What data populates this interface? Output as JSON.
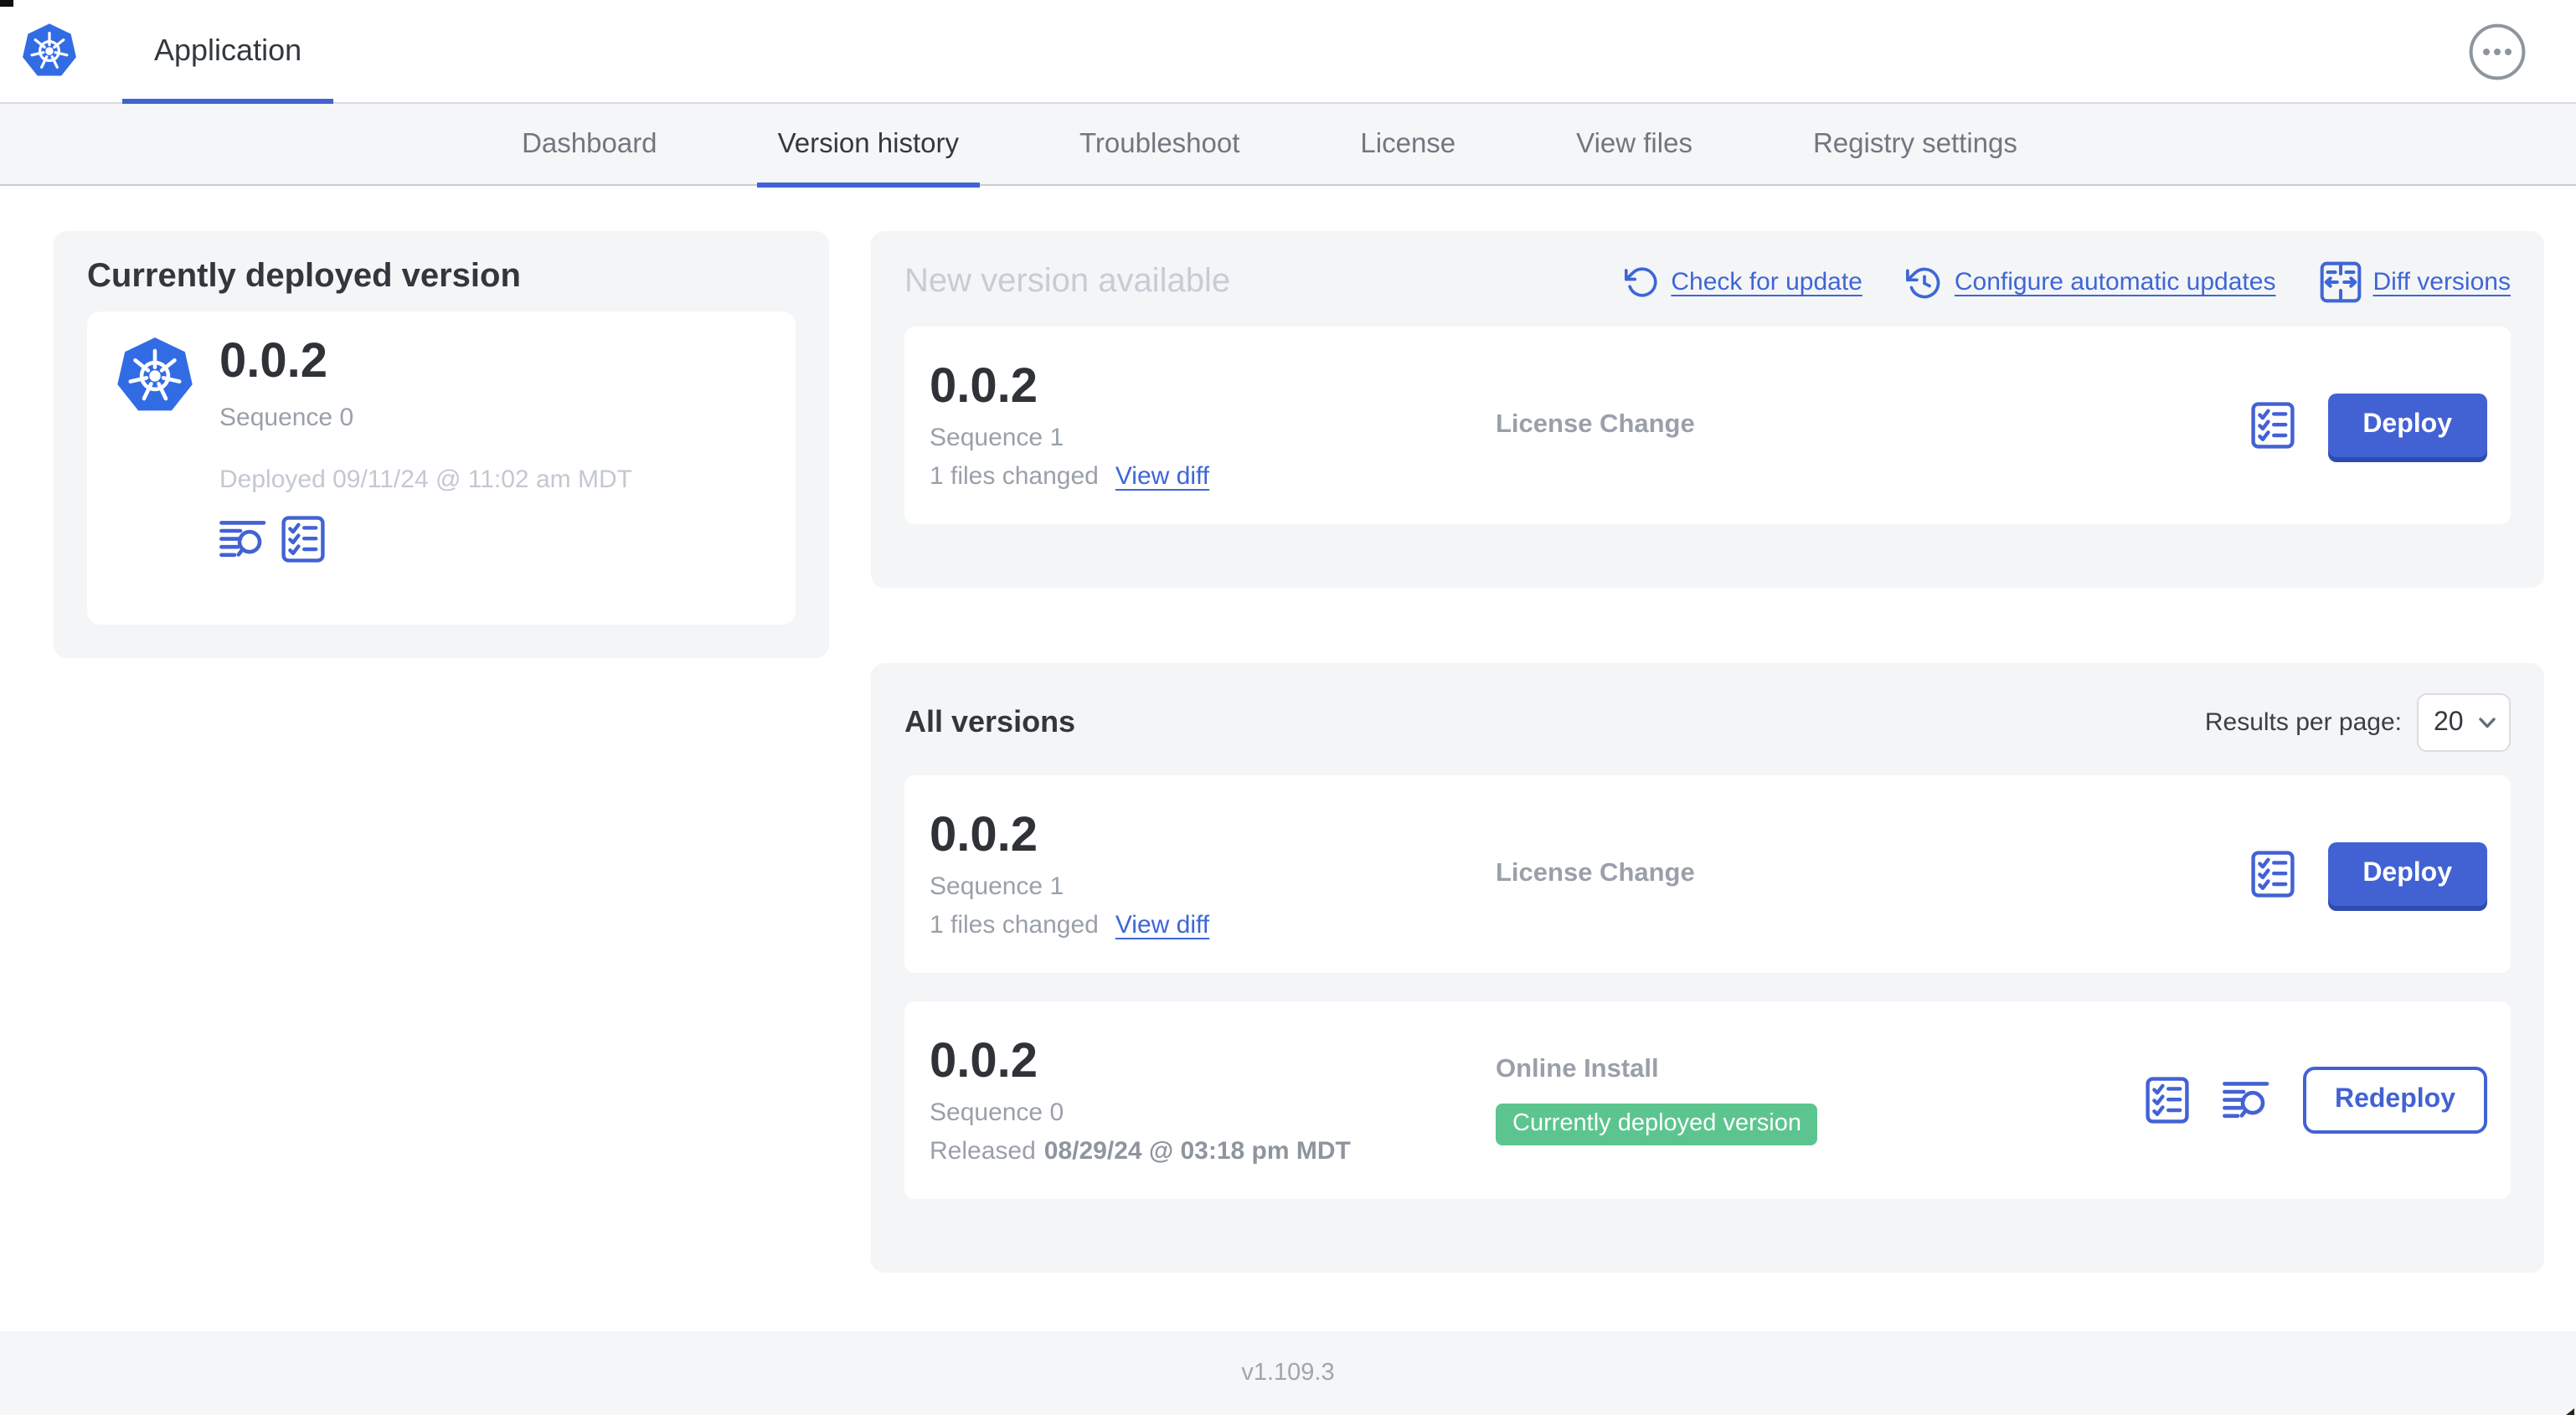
{
  "header": {
    "app_tab": "Application"
  },
  "nav": {
    "active_tab": "Version history",
    "tabs": [
      {
        "label": "Dashboard"
      },
      {
        "label": "Version history"
      },
      {
        "label": "Troubleshoot"
      },
      {
        "label": "License"
      },
      {
        "label": "View files"
      },
      {
        "label": "Registry settings"
      }
    ]
  },
  "current_version": {
    "title": "Currently deployed version",
    "version": "0.0.2",
    "sequence": "Sequence 0",
    "deployed": "Deployed 09/11/24 @ 11:02 am MDT"
  },
  "new_version": {
    "title": "New version available",
    "check_for_update": "Check for update",
    "configure_automatic_updates": "Configure automatic updates",
    "diff_versions": "Diff versions",
    "row": {
      "version": "0.0.2",
      "sequence": "Sequence 1",
      "files_changed": "1 files changed",
      "view_diff": "View diff",
      "source": "License Change",
      "action": "Deploy"
    }
  },
  "all_versions": {
    "title": "All versions",
    "results_per_page_label": "Results per page:",
    "results_per_page": "20",
    "rows": [
      {
        "version": "0.0.2",
        "sequence": "Sequence 1",
        "files_changed": "1 files changed",
        "view_diff": "View diff",
        "source": "License Change",
        "action": "Deploy"
      },
      {
        "version": "0.0.2",
        "sequence": "Sequence 0",
        "released_label": "Released",
        "released_date": "08/29/24 @ 03:18 pm MDT",
        "source": "Online Install",
        "badge": "Currently deployed version",
        "action": "Redeploy"
      }
    ]
  },
  "footer": {
    "app_version": "v1.109.3"
  },
  "colors": {
    "accent_blue": "#4262d4",
    "kubernetes_blue": "#326ce5",
    "success_green": "#5cc58f"
  }
}
